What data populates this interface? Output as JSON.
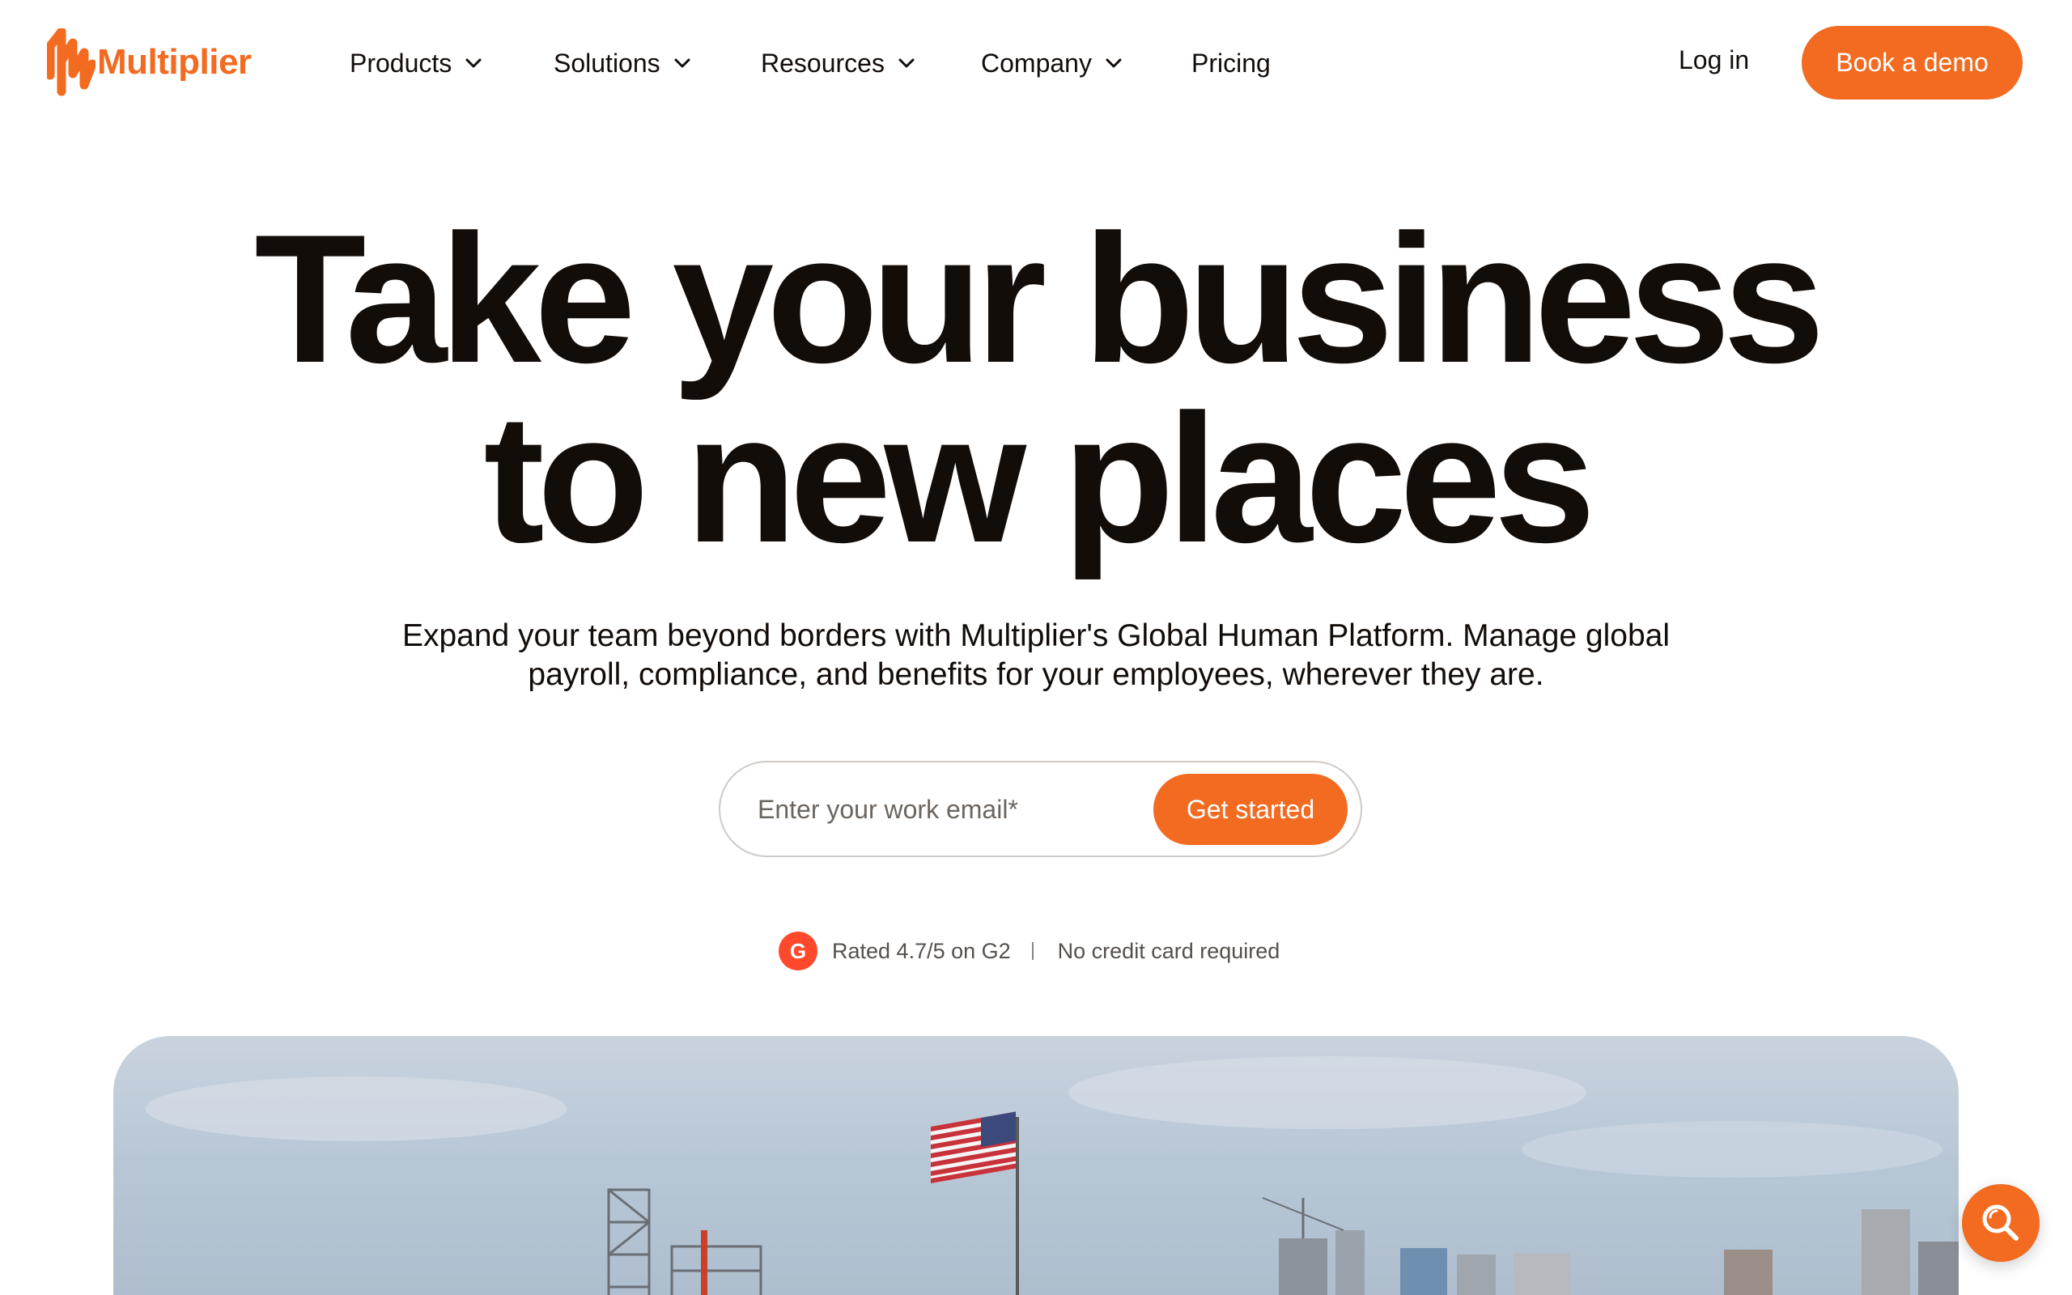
{
  "brand": {
    "name": "Multiplier",
    "accent_color": "#f26b21",
    "text_color": "#130d0a"
  },
  "nav": {
    "items": [
      {
        "label": "Products",
        "has_dropdown": true
      },
      {
        "label": "Solutions",
        "has_dropdown": true
      },
      {
        "label": "Resources",
        "has_dropdown": true
      },
      {
        "label": "Company",
        "has_dropdown": true
      },
      {
        "label": "Pricing",
        "has_dropdown": false
      }
    ],
    "login_label": "Log in",
    "cta_label": "Book a demo"
  },
  "hero": {
    "title_line1": "Take your business",
    "title_line2": "to new places",
    "subtitle": "Expand your team beyond borders with Multiplier's Global Human Platform. Manage global payroll, compliance, and benefits for your employees, wherever they are.",
    "email_placeholder": "Enter your work email*",
    "submit_label": "Get started",
    "rating_text": "Rated 4.7/5 on G2",
    "no_card_text": "No credit card required",
    "g2_badge_text": "G"
  },
  "icons": {
    "logo": "multiplier-logo-icon",
    "chevron": "chevron-down-icon",
    "g2": "g2-logo-icon",
    "search": "search-icon"
  }
}
